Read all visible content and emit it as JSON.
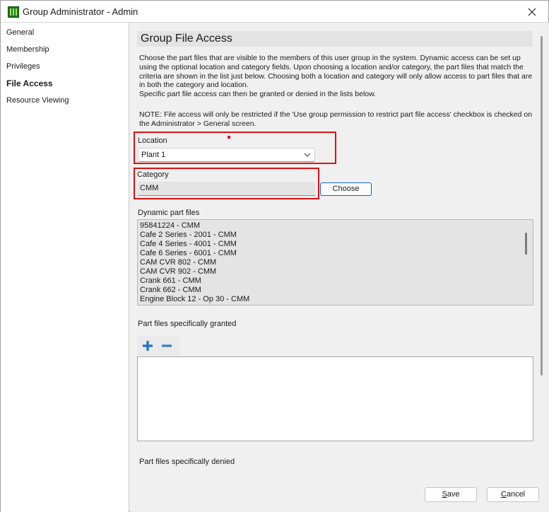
{
  "window": {
    "title": "Group Administrator - Admin"
  },
  "sidebar": {
    "items": [
      {
        "label": "General"
      },
      {
        "label": "Membership"
      },
      {
        "label": "Privileges"
      },
      {
        "label": "File Access"
      },
      {
        "label": "Resource Viewing"
      }
    ],
    "active_index": 3
  },
  "main": {
    "section_title": "Group File Access",
    "description": "Choose the part files that are visible to the members of this user group in the system. Dynamic access can be set up using the optional location and category fields. Upon choosing a location and/or category, the part files that match the criteria are shown in the list just below. Choosing both a location and category will only allow access to part files that are in both the category and location.",
    "description2": "Specific part file access can then be granted or denied in the lists below.",
    "note": "NOTE: File access will only be restricted if the 'Use group permission to restrict part file access' checkbox is checked on the Administrator > General screen.",
    "location": {
      "label": "Location",
      "value": "Plant 1"
    },
    "category": {
      "label": "Category",
      "value": "CMM",
      "choose_label": "Choose"
    },
    "dynamic_files": {
      "label": "Dynamic part files",
      "items": [
        "95841224 - CMM",
        "Cafe 2 Series - 2001 - CMM",
        "Cafe 4 Series - 4001 - CMM",
        "Cafe 6 Series - 6001 - CMM",
        "CAM CVR 802 - CMM",
        "CAM CVR 902 - CMM",
        "Crank 661 - CMM",
        "Crank 662 - CMM",
        "Engine Block 12 - Op 30 - CMM"
      ]
    },
    "granted": {
      "label": "Part files specifically granted"
    },
    "denied": {
      "label": "Part files specifically denied"
    }
  },
  "footer": {
    "save_prefix": "S",
    "save_rest": "ave",
    "cancel_prefix": "C",
    "cancel_rest": "ancel"
  },
  "colors": {
    "highlight_box": "#e01010",
    "accent": "#0a64c8",
    "add_icon": "#1a6fd0",
    "remove_icon": "#3a7ad0"
  },
  "icons": {
    "add": "plus-icon",
    "remove": "minus-icon",
    "close": "close-icon",
    "dropdown": "chevron-down-icon"
  }
}
